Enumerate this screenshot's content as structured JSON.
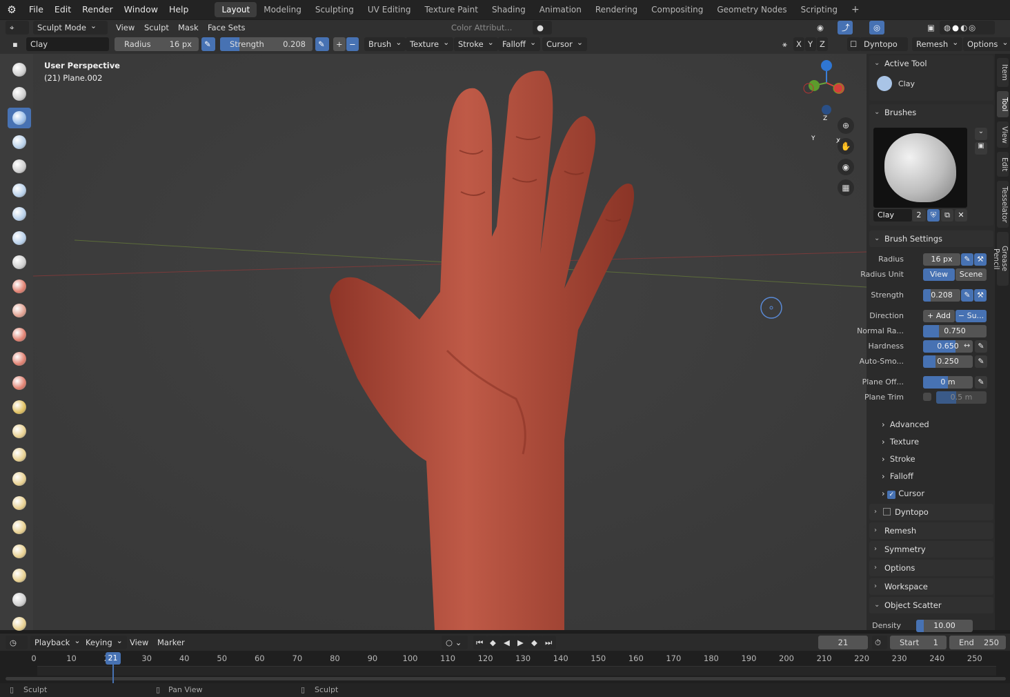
{
  "topbar": {
    "menus": [
      "File",
      "Edit",
      "Render",
      "Window",
      "Help"
    ],
    "workspaces": [
      "Layout",
      "Modeling",
      "Sculpting",
      "UV Editing",
      "Texture Paint",
      "Shading",
      "Animation",
      "Rendering",
      "Compositing",
      "Geometry Nodes",
      "Scripting"
    ],
    "active_workspace": "Layout"
  },
  "header": {
    "mode": "Sculpt Mode",
    "menus": [
      "View",
      "Sculpt",
      "Mask",
      "Face Sets"
    ],
    "color_attribute": "Color Attribut...",
    "axes": [
      "X",
      "Y",
      "Z"
    ],
    "right_items": [
      "Dyntopo",
      "Remesh",
      "Options"
    ]
  },
  "toolsettings": {
    "brush_name": "Clay",
    "radius_label": "Radius",
    "radius_value": "16 px",
    "strength_label": "Strength",
    "strength_value": "0.208",
    "strength_fraction": 0.208,
    "dropdowns": [
      "Brush",
      "Texture",
      "Stroke",
      "Falloff",
      "Cursor"
    ]
  },
  "viewport": {
    "perspective": "User Perspective",
    "object": "(21) Plane.002",
    "gizmo_axes": [
      "Z",
      "Y",
      "X"
    ],
    "skin_color": "#b4503f",
    "accent": "#4772b3"
  },
  "panel": {
    "tabs": [
      "Item",
      "Tool",
      "View",
      "Edit",
      "Tesselator",
      "Grease Pencil"
    ],
    "active_tab": "Tool",
    "active_tool_title": "Active Tool",
    "active_tool_name": "Clay",
    "brushes_title": "Brushes",
    "brush_name": "Clay",
    "brush_users": "2",
    "brush_settings_title": "Brush Settings",
    "radius_label": "Radius",
    "radius_value": "16 px",
    "radius_unit_label": "Radius Unit",
    "radius_unit_options": [
      "View",
      "Scene"
    ],
    "strength_label": "Strength",
    "strength_value": "0.208",
    "direction_label": "Direction",
    "direction_add": "Add",
    "direction_sub": "Su...",
    "normal_radius_label": "Normal Ra...",
    "normal_radius_value": "0.750",
    "normal_radius_fraction": 0.25,
    "hardness_label": "Hardness",
    "hardness_value": "0.650",
    "hardness_fraction": 0.65,
    "autosmooth_label": "Auto-Smo...",
    "autosmooth_value": "0.250",
    "autosmooth_fraction": 0.25,
    "plane_offset_label": "Plane Off...",
    "plane_offset_value": "0 m",
    "plane_trim_label": "Plane Trim",
    "plane_trim_value": "0.5 m",
    "subpanels": [
      "Advanced",
      "Texture",
      "Stroke",
      "Falloff",
      "Cursor"
    ],
    "sections": [
      "Dyntopo",
      "Remesh",
      "Symmetry",
      "Options",
      "Workspace"
    ],
    "object_scatter_title": "Object Scatter",
    "density_label": "Density",
    "density_value": "10.00"
  },
  "timeline": {
    "menus": [
      "Playback",
      "Keying",
      "View",
      "Marker"
    ],
    "current_frame": "21",
    "start_label": "Start",
    "start_value": "1",
    "end_label": "End",
    "end_value": "250",
    "ticks": [
      "0",
      "10",
      "20",
      "30",
      "40",
      "50",
      "60",
      "70",
      "80",
      "90",
      "100",
      "110",
      "120",
      "130",
      "140",
      "150",
      "160",
      "170",
      "180",
      "190",
      "200",
      "210",
      "220",
      "230",
      "240",
      "250"
    ]
  },
  "status": {
    "items": [
      "Sculpt",
      "Pan View",
      "Sculpt"
    ]
  }
}
